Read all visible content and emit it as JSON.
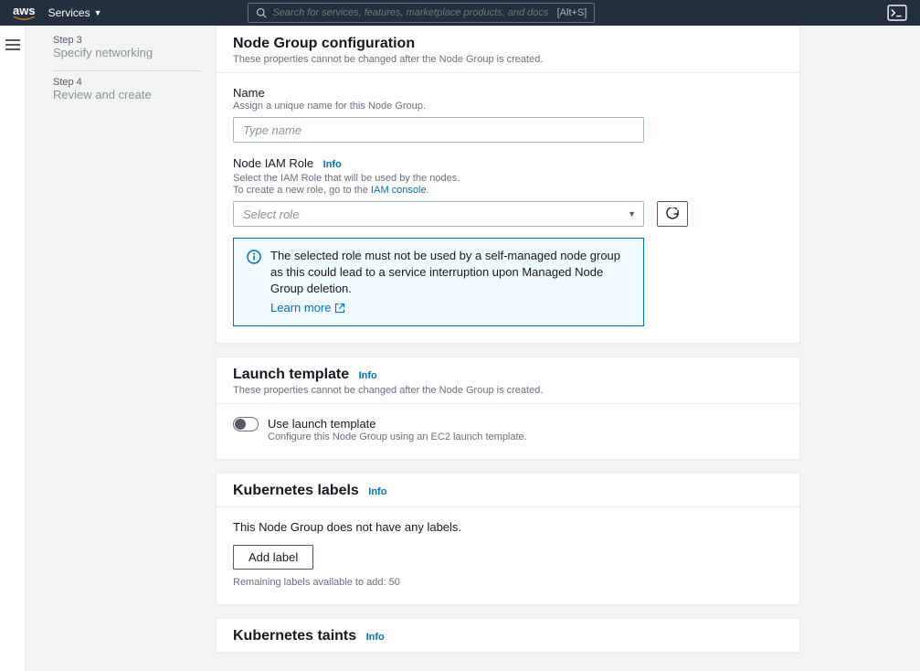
{
  "topnav": {
    "logo": "aws",
    "services_label": "Services",
    "search_placeholder": "Search for services, features, marketplace products, and docs",
    "search_shortcut": "[Alt+S]"
  },
  "steps": [
    {
      "num": "Step 3",
      "title": "Specify networking"
    },
    {
      "num": "Step 4",
      "title": "Review and create"
    }
  ],
  "config_panel": {
    "title": "Node Group configuration",
    "desc": "These properties cannot be changed after the Node Group is created.",
    "name_label": "Name",
    "name_hint": "Assign a unique name for this Node Group.",
    "name_placeholder": "Type name",
    "iam_label": "Node IAM Role",
    "iam_info": "Info",
    "iam_hint1": "Select the IAM Role that will be used by the nodes.",
    "iam_hint2_prefix": "To create a new role, go to the ",
    "iam_hint2_link": "IAM console",
    "iam_hint2_suffix": ".",
    "iam_select_placeholder": "Select role",
    "info_box_text": "The selected role must not be used by a self-managed node group as this could lead to a service interruption upon Managed Node Group deletion.",
    "info_box_learn": "Learn more"
  },
  "launch_panel": {
    "title": "Launch template",
    "info": "Info",
    "desc": "These properties cannot be changed after the Node Group is created.",
    "toggle_label": "Use launch template",
    "toggle_hint": "Configure this Node Group using an EC2 launch template."
  },
  "labels_panel": {
    "title": "Kubernetes labels",
    "info": "Info",
    "empty": "This Node Group does not have any labels.",
    "add_btn": "Add label",
    "remaining": "Remaining labels available to add: 50"
  },
  "taints_panel": {
    "title": "Kubernetes taints",
    "info": "Info"
  },
  "icons": {
    "search": "search-icon",
    "cloudshell": "cloudshell-icon",
    "menu": "menu-icon",
    "refresh": "refresh-icon",
    "info_circle": "info-icon",
    "external": "external-link-icon",
    "caret": "caret-down-icon"
  }
}
